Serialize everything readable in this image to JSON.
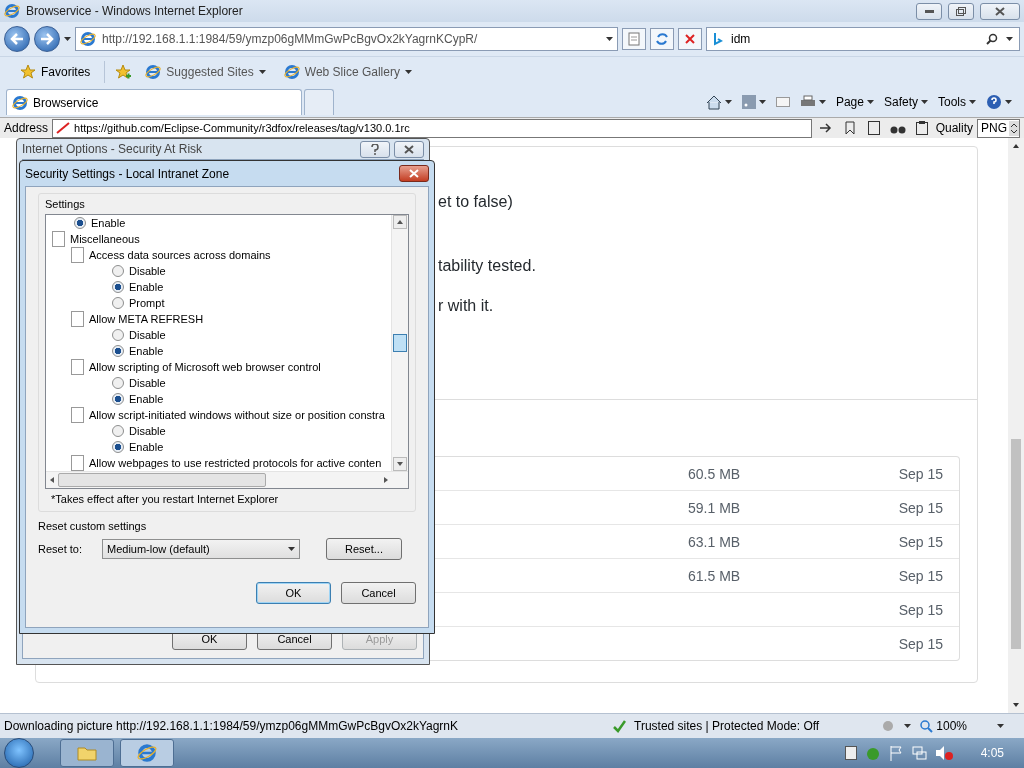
{
  "window": {
    "title": "Browservice - Windows Internet Explorer"
  },
  "navigation": {
    "url": "http://192.168.1.1:1984/59/ymzp06gMMmGwPcBgvOx2kYagrnKCypR/",
    "search": "idm"
  },
  "favorites_bar": {
    "favorites": "Favorites",
    "links": [
      "Suggested Sites",
      "Web Slice Gallery"
    ]
  },
  "tabs": [
    {
      "label": "Browservice",
      "selected": true
    }
  ],
  "command_bar": {
    "menus": [
      "Page",
      "Safety",
      "Tools"
    ]
  },
  "page": {
    "toolbar": {
      "address_label": "Address",
      "address": "https://github.com/Eclipse-Community/r3dfox/releases/tag/v130.0.1rc",
      "quality_label": "Quality",
      "quality": "PNG"
    },
    "text_fragments": [
      "et to false)",
      "tability tested.",
      "r with it."
    ],
    "table_rows": [
      {
        "size": "60.5 MB",
        "date": "Sep 15"
      },
      {
        "size": "59.1 MB",
        "date": "Sep 15"
      },
      {
        "size": "63.1 MB",
        "date": "Sep 15"
      },
      {
        "size": "61.5 MB",
        "date": "Sep 15"
      },
      {
        "date": "Sep 15"
      },
      {
        "date": "Sep 15"
      }
    ]
  },
  "internet_options_dialog": {
    "title": "Internet Options - Security At Risk",
    "buttons": [
      {
        "label": "OK",
        "disabled": false
      },
      {
        "label": "Cancel",
        "disabled": false
      },
      {
        "label": "Apply",
        "disabled": true
      }
    ]
  },
  "security_settings_dialog": {
    "title": "Security Settings - Local Intranet Zone",
    "settings_label": "Settings",
    "tree": [
      {
        "kind": "radio",
        "label": "Enable",
        "selected": true
      },
      {
        "kind": "group",
        "label": "Miscellaneous",
        "children": [
          {
            "kind": "setting",
            "label": "Access data sources across domains",
            "children": [
              {
                "kind": "radio",
                "label": "Disable",
                "selected": false
              },
              {
                "kind": "radio",
                "label": "Enable",
                "selected": true
              },
              {
                "kind": "radio",
                "label": "Prompt",
                "selected": false
              }
            ]
          },
          {
            "kind": "setting",
            "label": "Allow META REFRESH",
            "children": [
              {
                "kind": "radio",
                "label": "Disable",
                "selected": false
              },
              {
                "kind": "radio",
                "label": "Enable",
                "selected": true
              }
            ]
          },
          {
            "kind": "setting",
            "label": "Allow scripting of Microsoft web browser control",
            "children": [
              {
                "kind": "radio",
                "label": "Disable",
                "selected": false
              },
              {
                "kind": "radio",
                "label": "Enable",
                "selected": true
              }
            ]
          },
          {
            "kind": "setting",
            "label": "Allow script-initiated windows without size or position constra",
            "children": [
              {
                "kind": "radio",
                "label": "Disable",
                "selected": false
              },
              {
                "kind": "radio",
                "label": "Enable",
                "selected": true
              }
            ]
          },
          {
            "kind": "setting",
            "label": "Allow webpages to use restricted protocols for active conten"
          }
        ]
      }
    ],
    "note": "*Takes effect after you restart Internet Explorer",
    "reset_group": "Reset custom settings",
    "reset_label": "Reset to:",
    "reset_level": "Medium-low (default)",
    "reset_button": "Reset...",
    "buttons": [
      {
        "label": "OK",
        "default": true
      },
      {
        "label": "Cancel",
        "default": false
      }
    ]
  },
  "status_bar": {
    "message": "Downloading picture http://192.168.1.1:1984/59/ymzp06gMMmGwPcBgvOx2kYagrnK",
    "zone": "Trusted sites | Protected Mode: Off",
    "zoom": "100%"
  },
  "taskbar": {
    "clock": "4:05"
  }
}
